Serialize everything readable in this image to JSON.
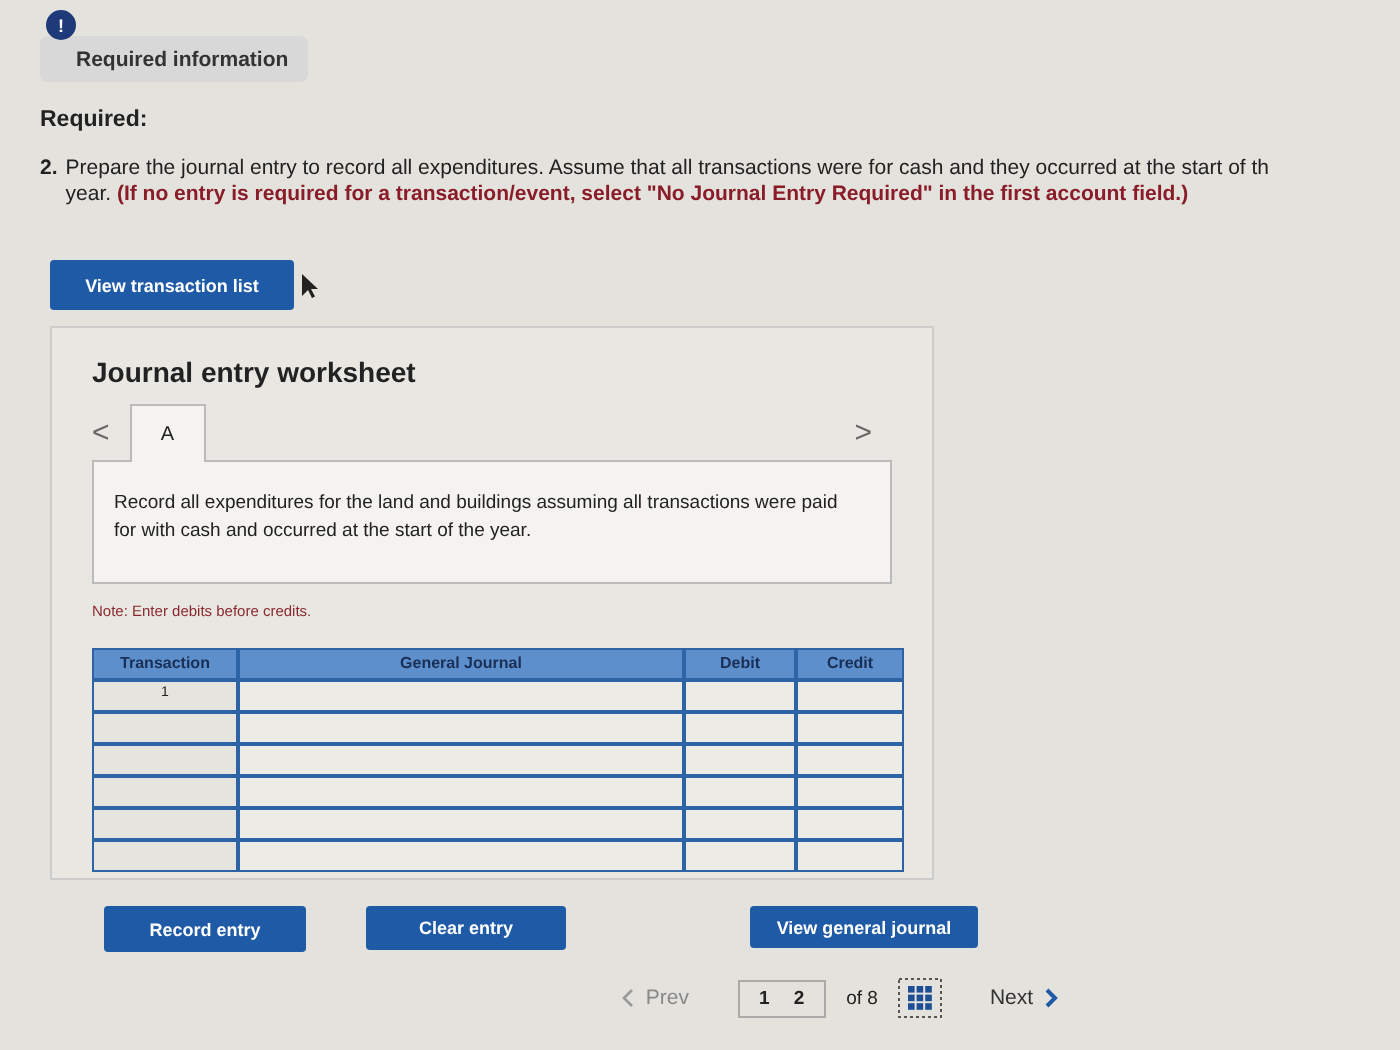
{
  "info_tab": {
    "icon": "!",
    "label": "Required information"
  },
  "heading": "Required:",
  "question": {
    "number": "2.",
    "lines": [
      "Prepare the journal entry to record all expenditures. Assume that all transactions were for cash and they occurred at the start of th",
      "year. **(If no entry is required for a transaction/event, select \"No Journal Entry Required\" in the first account field.)**"
    ]
  },
  "view_list_button": "View transaction list",
  "worksheet": {
    "title": "Journal entry worksheet",
    "prev_arrow": "<",
    "next_arrow": ">",
    "tabs": [
      {
        "label": "A",
        "selected": true
      }
    ],
    "description": "Record all expenditures for the land and buildings assuming all transactions were paid for with cash and occurred at the start of the year.",
    "note": "Note: Enter debits before credits.",
    "table": {
      "columns": [
        "Transaction",
        "General Journal",
        "Debit",
        "Credit"
      ],
      "rows": [
        {
          "transaction": "1"
        },
        {
          "transaction": ""
        },
        {
          "transaction": ""
        },
        {
          "transaction": ""
        },
        {
          "transaction": ""
        },
        {
          "transaction": ""
        }
      ]
    },
    "buttons": [
      "Record entry",
      "Clear entry",
      "View general journal"
    ]
  },
  "pager": {
    "prev": {
      "label": "Prev",
      "disabled": true
    },
    "pages": [
      "1",
      "2"
    ],
    "of": "of 8",
    "next": {
      "label": "Next",
      "disabled": false
    }
  }
}
